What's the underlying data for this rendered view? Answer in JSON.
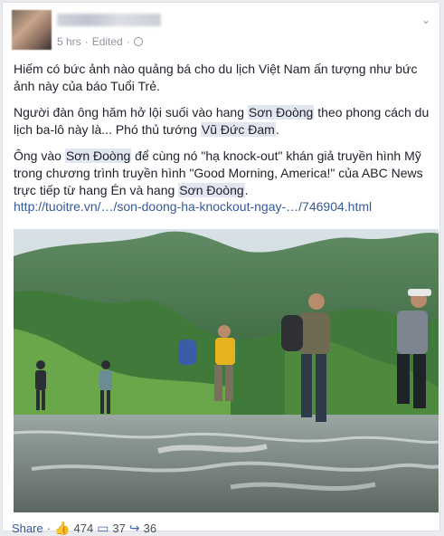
{
  "post": {
    "meta": {
      "time": "5 hrs",
      "dot": "·",
      "edited": "Edited",
      "dot2": "·"
    },
    "paragraphs": {
      "p1": "Hiếm có bức ảnh nào quảng bá cho du lịch Việt Nam ấn tượng như bức ảnh này của báo Tuổi Trẻ.",
      "p2_a": "Người đàn ông hăm hở lội suối vào hang ",
      "p2_tag1": "Sơn Đoòng",
      "p2_b": " theo phong cách du lịch ba-lô này là... Phó thủ tướng ",
      "p2_tag2": "Vũ Đức Đam",
      "p2_c": ".",
      "p3_a": "Ông vào ",
      "p3_tag1": "Sơn Đoòng",
      "p3_b": " để cùng nó \"hạ knock-out\" khán giả truyền hình Mỹ trong chương trình truyền hình \"Good Morning, America!\" của ABC News trực tiếp từ hang Én và hang ",
      "p3_tag2": "Sơn Đoòng",
      "p3_c": "."
    },
    "link": "http://tuoitre.vn/…/son-doong-ha-knockout-ngay-…/746904.html"
  },
  "footer": {
    "share": "Share",
    "dot": "·",
    "likes": "474",
    "comments": "37",
    "shares": "36"
  },
  "colors": {
    "link": "#365899",
    "tag_bg": "#e1e6f0",
    "meta": "#90949c"
  },
  "icons": [
    "chevron-down-icon",
    "globe-icon",
    "like-icon",
    "comment-icon",
    "share-arrow-icon"
  ]
}
